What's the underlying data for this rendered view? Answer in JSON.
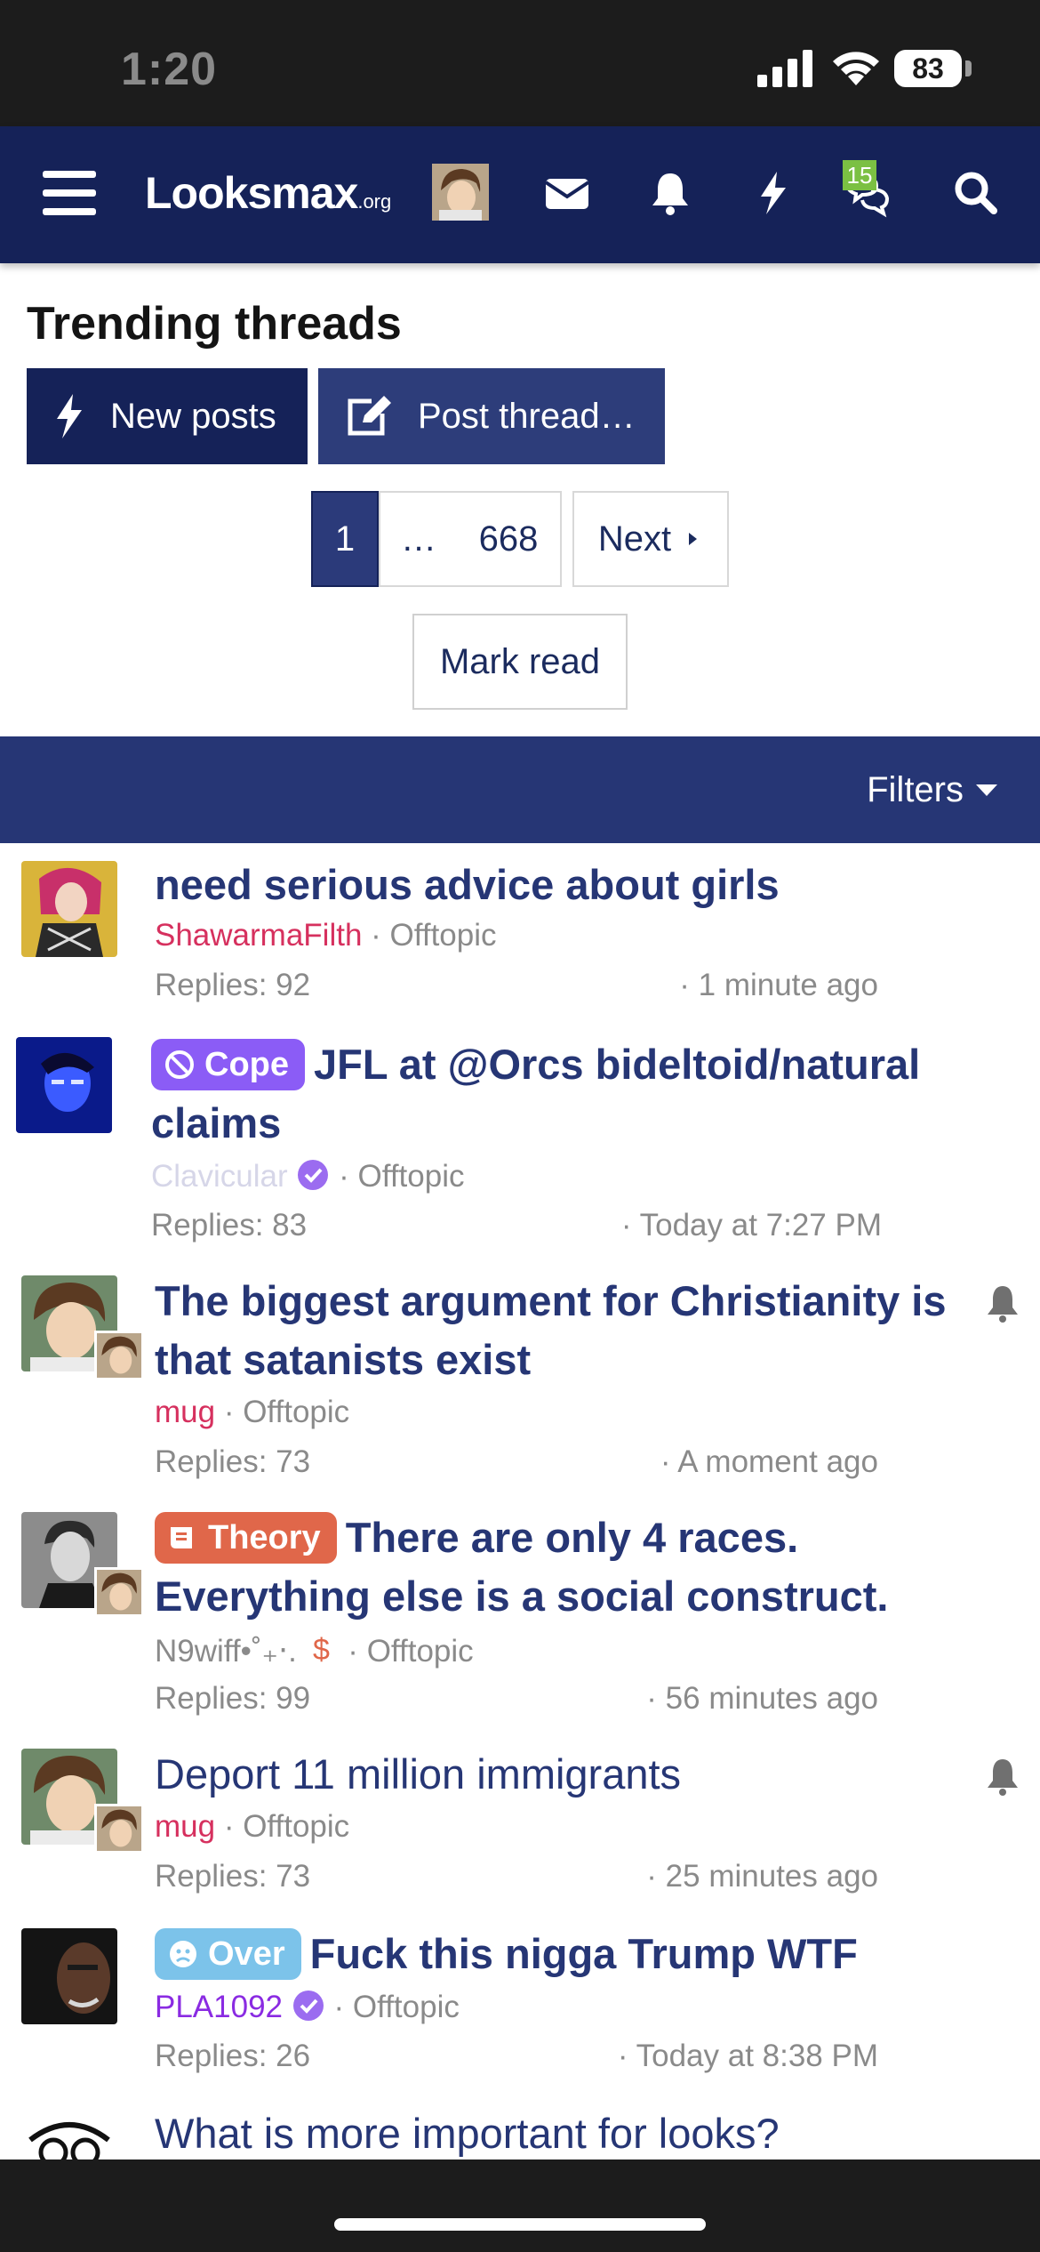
{
  "status_bar": {
    "time": "1:20",
    "battery": "83"
  },
  "nav": {
    "logo_main": "Looksmax",
    "logo_suffix": ".org",
    "conversations_badge": "15",
    "icons": [
      "menu-icon",
      "envelope-icon",
      "bell-icon",
      "bolt-icon",
      "conversations-icon",
      "search-icon"
    ]
  },
  "page": {
    "title": "Trending threads",
    "new_posts_label": "New posts",
    "post_thread_label": "Post thread…",
    "pagination": {
      "current": "1",
      "ellipsis": "…",
      "last": "668",
      "next": "Next"
    },
    "mark_read_label": "Mark read",
    "filters_label": "Filters"
  },
  "threads": [
    {
      "title": "need serious advice about girls",
      "prefix": "",
      "author": "ShawarmaFilth",
      "forum": "Offtopic",
      "replies": "Replies: 92",
      "time": "1 minute ago",
      "watched": false
    },
    {
      "title": "JFL at @Orcs bideltoid/natural claims",
      "prefix": "Cope",
      "author": "Clavicular",
      "forum": "Offtopic",
      "replies": "Replies: 83",
      "time": "Today at 7:27 PM",
      "watched": false
    },
    {
      "title": "The biggest argument for Christianity is that satanists exist",
      "prefix": "",
      "author": "mug",
      "forum": "Offtopic",
      "replies": "Replies: 73",
      "time": "A moment ago",
      "watched": true
    },
    {
      "title": "There are only 4 races. Everything else is a social construct.",
      "prefix": "Theory",
      "author": "N9wiff•˚₊‧.",
      "forum": "Offtopic",
      "replies": "Replies: 99",
      "time": "56 minutes ago",
      "watched": false
    },
    {
      "title": "Deport 11 million immigrants",
      "prefix": "",
      "author": "mug",
      "forum": "Offtopic",
      "replies": "Replies: 73",
      "time": "25 minutes ago",
      "watched": true
    },
    {
      "title": "Fuck this nigga Trump WTF",
      "prefix": "Over",
      "author": "PLA1092",
      "forum": "Offtopic",
      "replies": "Replies: 26",
      "time": "Today at 8:38 PM",
      "watched": false
    },
    {
      "title": "What is more important for looks?",
      "prefix": "",
      "author": "",
      "forum": "",
      "replies": "",
      "time": "",
      "watched": false
    }
  ],
  "colors": {
    "nav_bg": "#152258",
    "accent_blue": "#263675",
    "cope_prefix": "#8b5cf6",
    "theory_prefix": "#e0674a",
    "over_prefix": "#7cc3ea",
    "author_red": "#d6305e"
  }
}
